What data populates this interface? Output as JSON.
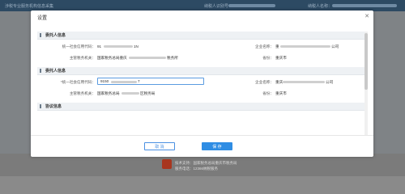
{
  "background": {
    "header_left": "涉税专业服务机构信息采集",
    "header_mid": "纳税人识别号：",
    "header_right": "纳税人名称：",
    "footer_line1": "技术支持：国家税务总局重庆市税务局",
    "footer_line2": "服务电话：12366纳税服务"
  },
  "modal": {
    "title": "设置",
    "close_icon": "close-icon",
    "sections": [
      {
        "title": "委托人信息",
        "fields": {
          "credit_code_label": "统一社会信用代码：",
          "credit_code_value": "91",
          "credit_code_tail": "1N",
          "company_name_label": "企业名称：",
          "company_name_value": "重",
          "company_name_tail": "公司",
          "tax_authority_label": "主管税务机关：",
          "tax_authority_value": "国家税务总局重庆",
          "tax_authority_tail": "税务所",
          "region_label": "省份：",
          "region_value": "重庆市"
        }
      },
      {
        "title": "委托人信息",
        "fields": {
          "credit_code_label": "*统一社会信用代码：",
          "credit_code_value": "9150",
          "credit_code_tail": "7",
          "company_name_label": "企业名称：",
          "company_name_value": "重庆",
          "company_name_tail": "公司",
          "tax_authority_label": "主管税务机关：",
          "tax_authority_value": "国家税务总局",
          "tax_authority_tail": "区税务局",
          "region_label": "省份：",
          "region_value": "重庆市"
        }
      },
      {
        "title": "协议信息"
      }
    ],
    "cancel_label": "取 消",
    "save_label": "保 存"
  },
  "colors": {
    "primary": "#2f8de4",
    "header": "#2d4a63",
    "logo": "#a8361f"
  }
}
